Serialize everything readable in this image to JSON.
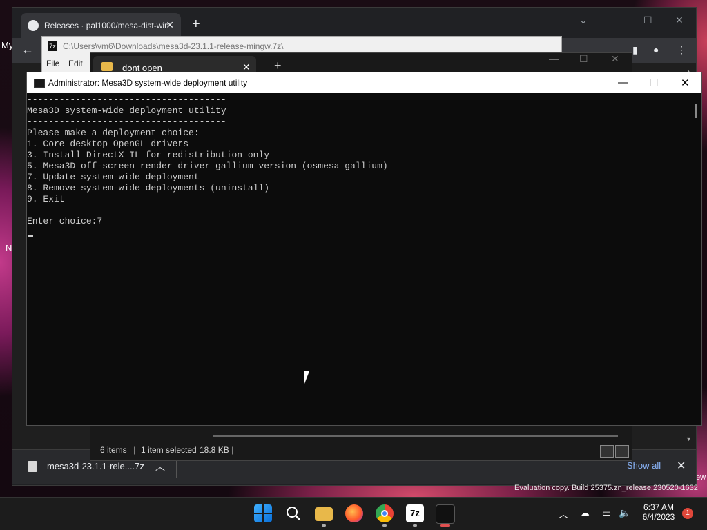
{
  "desktop": {
    "left_text_1": "My",
    "left_text_2": "N",
    "right_text": "ew",
    "evaluation_text": "Evaluation copy. Build 25375.zn_release.230520-1632"
  },
  "chrome": {
    "tab_title": "Releases · pal1000/mesa-dist-win",
    "new_tab_icon": "plus-icon",
    "download": {
      "file_name": "mesa3d-23.1.1-rele....7z",
      "show_all": "Show all"
    }
  },
  "sevenzip": {
    "path": "C:\\Users\\vm6\\Downloads\\mesa3d-23.1.1-release-mingw.7z\\",
    "menu": [
      "File",
      "Edit"
    ]
  },
  "explorer": {
    "tab_title": "dont open",
    "status": {
      "items": "6 items",
      "selected": "1 item selected",
      "size": "18.8 KB"
    }
  },
  "console": {
    "title": "Administrator:  Mesa3D system-wide deployment utility",
    "lines": [
      "-------------------------------------",
      "Mesa3D system-wide deployment utility",
      "-------------------------------------",
      "Please make a deployment choice:",
      "1. Core desktop OpenGL drivers",
      "3. Install DirectX IL for redistribution only",
      "5. Mesa3D off-screen render driver gallium version (osmesa gallium)",
      "7. Update system-wide deployment",
      "8. Remove system-wide deployments (uninstall)",
      "9. Exit",
      "",
      "Enter choice:7"
    ]
  },
  "taskbar": {
    "time": "6:37 AM",
    "date": "6/4/2023",
    "notification_count": "1",
    "sevenzip_label": "7z"
  }
}
